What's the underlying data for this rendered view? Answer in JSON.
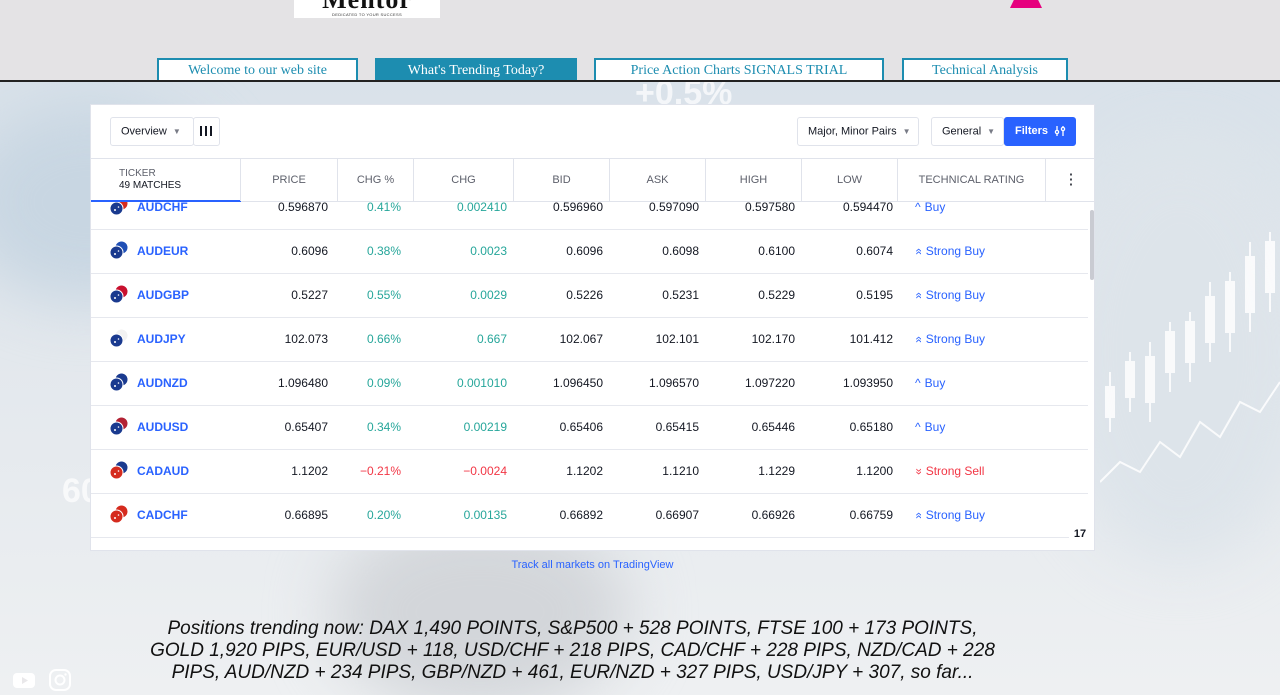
{
  "header": {
    "logo_text": "Mentor",
    "logo_tagline": "DEDICATED TO YOUR SUCCESS"
  },
  "nav": {
    "tabs": [
      {
        "label": "Welcome to our web site",
        "active": false
      },
      {
        "label": "What's Trending Today?",
        "active": true
      },
      {
        "label": "Price Action Charts SIGNALS TRIAL",
        "active": false
      },
      {
        "label": "Technical Analysis",
        "active": false
      }
    ]
  },
  "hero": {
    "bg_numbers": [
      "+0.5%",
      "60"
    ]
  },
  "screener": {
    "toolbar": {
      "view_label": "Overview",
      "pairs_label": "Major, Minor Pairs",
      "category_label": "General",
      "filters_label": "Filters"
    },
    "columns": {
      "ticker": "TICKER",
      "matches": "49 MATCHES",
      "price": "PRICE",
      "chg_pct": "CHG %",
      "chg": "CHG",
      "bid": "BID",
      "ask": "ASK",
      "high": "HIGH",
      "low": "LOW",
      "rating": "TECHNICAL RATING"
    },
    "rows": [
      {
        "symbol": "AUDCHF",
        "price": "0.596870",
        "chg_pct": "0.41%",
        "chg": "0.002410",
        "bid": "0.596960",
        "ask": "0.597090",
        "high": "0.597580",
        "low": "0.594470",
        "rating": "Buy",
        "rating_icon": "^",
        "dir": "pos",
        "rating_class": "buy",
        "flag_colors": [
          "#1a3a8f",
          "#d52b1e"
        ]
      },
      {
        "symbol": "AUDEUR",
        "price": "0.6096",
        "chg_pct": "0.38%",
        "chg": "0.0023",
        "bid": "0.6096",
        "ask": "0.6098",
        "high": "0.6100",
        "low": "0.6074",
        "rating": "Strong Buy",
        "rating_icon": "»",
        "dir": "pos",
        "rating_class": "buy",
        "flag_colors": [
          "#1a3a8f",
          "#1f4fb5"
        ]
      },
      {
        "symbol": "AUDGBP",
        "price": "0.5227",
        "chg_pct": "0.55%",
        "chg": "0.0029",
        "bid": "0.5226",
        "ask": "0.5231",
        "high": "0.5229",
        "low": "0.5195",
        "rating": "Strong Buy",
        "rating_icon": "»",
        "dir": "pos",
        "rating_class": "buy",
        "flag_colors": [
          "#1a3a8f",
          "#c8102e"
        ]
      },
      {
        "symbol": "AUDJPY",
        "price": "102.073",
        "chg_pct": "0.66%",
        "chg": "0.667",
        "bid": "102.067",
        "ask": "102.101",
        "high": "102.170",
        "low": "101.412",
        "rating": "Strong Buy",
        "rating_icon": "»",
        "dir": "pos",
        "rating_class": "buy",
        "flag_colors": [
          "#1a3a8f",
          "#f2f2f2"
        ]
      },
      {
        "symbol": "AUDNZD",
        "price": "1.096480",
        "chg_pct": "0.09%",
        "chg": "0.001010",
        "bid": "1.096450",
        "ask": "1.096570",
        "high": "1.097220",
        "low": "1.093950",
        "rating": "Buy",
        "rating_icon": "^",
        "dir": "pos",
        "rating_class": "buy",
        "flag_colors": [
          "#1a3a8f",
          "#1a3a8f"
        ]
      },
      {
        "symbol": "AUDUSD",
        "price": "0.65407",
        "chg_pct": "0.34%",
        "chg": "0.00219",
        "bid": "0.65406",
        "ask": "0.65415",
        "high": "0.65446",
        "low": "0.65180",
        "rating": "Buy",
        "rating_icon": "^",
        "dir": "pos",
        "rating_class": "buy",
        "flag_colors": [
          "#1a3a8f",
          "#b22234"
        ]
      },
      {
        "symbol": "CADAUD",
        "price": "1.1202",
        "chg_pct": "−0.21%",
        "chg": "−0.0024",
        "bid": "1.1202",
        "ask": "1.1210",
        "high": "1.1229",
        "low": "1.1200",
        "rating": "Strong Sell",
        "rating_icon": "«",
        "dir": "neg",
        "rating_class": "sell",
        "flag_colors": [
          "#d52b1e",
          "#1a3a8f"
        ]
      },
      {
        "symbol": "CADCHF",
        "price": "0.66895",
        "chg_pct": "0.20%",
        "chg": "0.00135",
        "bid": "0.66892",
        "ask": "0.66907",
        "high": "0.66926",
        "low": "0.66759",
        "rating": "Strong Buy",
        "rating_icon": "»",
        "dir": "pos",
        "rating_class": "buy",
        "flag_colors": [
          "#d52b1e",
          "#d52b1e"
        ]
      }
    ],
    "badge": "17"
  },
  "track_link": "Track all markets on TradingView",
  "trending_text": "Positions trending now: DAX 1,490 POINTS, S&P500 + 528 POINTS, FTSE 100 + 173 POINTS, GOLD 1,920 PIPS, EUR/USD + 118, USD/CHF + 218 PIPS, CAD/CHF + 228 PIPS, NZD/CAD + 228 PIPS, AUD/NZD + 234 PIPS, GBP/NZD + 461, EUR/NZD + 327 PIPS, USD/JPY + 307, so far...",
  "colors": {
    "accent": "#2962ff",
    "nav_teal": "#1d8db0",
    "positive": "#26a69a",
    "negative": "#f23645"
  },
  "icons": {
    "columns": "columns-icon",
    "filters": "filters-icon",
    "more": "more-vertical-icon",
    "youtube": "youtube-icon",
    "instagram": "instagram-icon"
  }
}
